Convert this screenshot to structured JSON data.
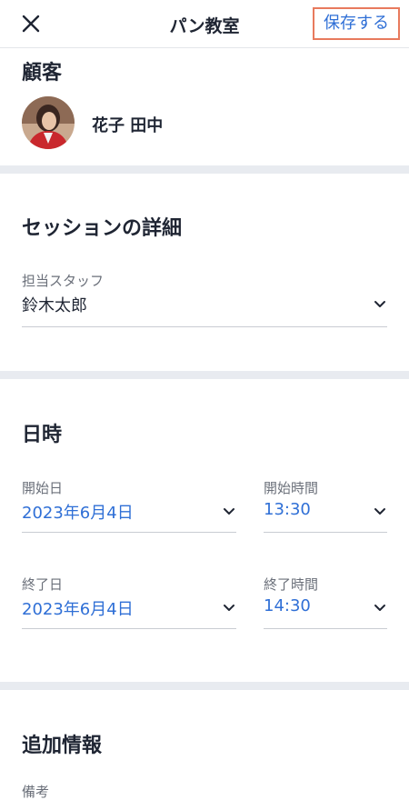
{
  "header": {
    "close_icon": "close-icon",
    "title": "パン教室",
    "save_label": "保存する"
  },
  "customer": {
    "heading": "顧客",
    "name": "花子 田中",
    "avatar_icon": "avatar-photo"
  },
  "session": {
    "heading": "セッションの詳細",
    "staff_label": "担当スタッフ",
    "staff_value": "鈴木太郎"
  },
  "datetime": {
    "heading": "日時",
    "start_date_label": "開始日",
    "start_date_value": "2023年6月4日",
    "start_time_label": "開始時間",
    "start_time_value": "13:30",
    "end_date_label": "終了日",
    "end_date_value": "2023年6月4日",
    "end_time_label": "終了時間",
    "end_time_value": "14:30"
  },
  "additional": {
    "heading": "追加情報",
    "notes_label": "備考"
  },
  "colors": {
    "accent": "#2f6fd6",
    "highlight_border": "#e87a5d",
    "section_divider": "#e8ebf0"
  }
}
